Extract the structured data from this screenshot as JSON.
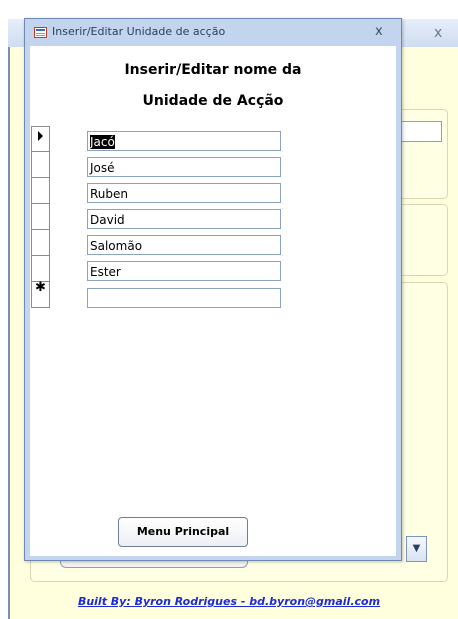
{
  "background_window": {
    "close_label": "x",
    "credit_text": "Built By: Byron Rodrigues - bd.byron@gmail.com",
    "dropdown_arrow": "▼"
  },
  "dialog": {
    "title": "Inserir/Editar Unidade de acção",
    "close_label": "x",
    "heading_line1": "Inserir/Editar nome da",
    "heading_line2": "Unidade de Acção",
    "records": [
      {
        "value": "Jacó",
        "current": true
      },
      {
        "value": "José"
      },
      {
        "value": "Ruben"
      },
      {
        "value": "David"
      },
      {
        "value": "Salomão"
      },
      {
        "value": "Ester"
      },
      {
        "value": "",
        "new_record": true
      }
    ],
    "new_record_marker": "✱",
    "menu_button_label": "Menu Principal"
  }
}
